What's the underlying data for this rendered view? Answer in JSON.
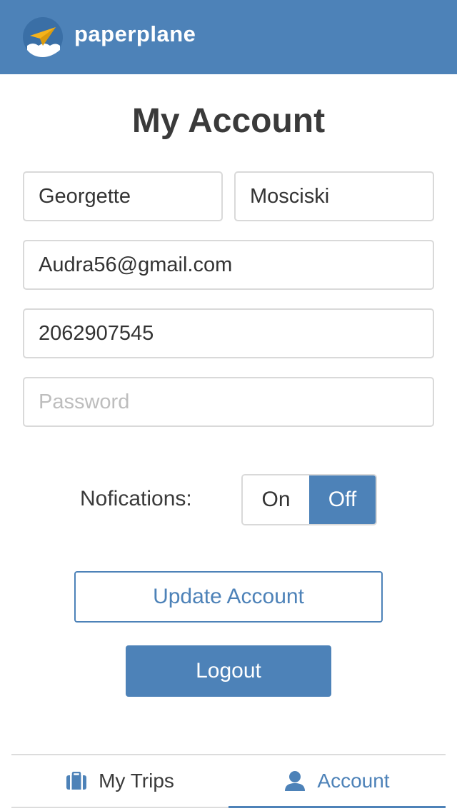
{
  "header": {
    "brand": "paperplane",
    "logo_icon": "paper-plane-icon"
  },
  "page": {
    "title": "My Account"
  },
  "form": {
    "first_name": "Georgette",
    "last_name": "Mosciski",
    "email": "Audra56@gmail.com",
    "phone": "2062907545",
    "password_placeholder": "Password",
    "password_value": ""
  },
  "notifications": {
    "label": "Nofications:",
    "on_label": "On",
    "off_label": "Off",
    "selected": "Off"
  },
  "actions": {
    "update_label": "Update Account",
    "logout_label": "Logout"
  },
  "bottom_nav": {
    "tabs": [
      {
        "label": "My Trips",
        "icon": "briefcase-icon",
        "active": false
      },
      {
        "label": "Account",
        "icon": "user-icon",
        "active": true
      }
    ]
  },
  "colors": {
    "accent": "#4d82b8",
    "border": "#d9d9d9",
    "text": "#3a3a3a"
  }
}
